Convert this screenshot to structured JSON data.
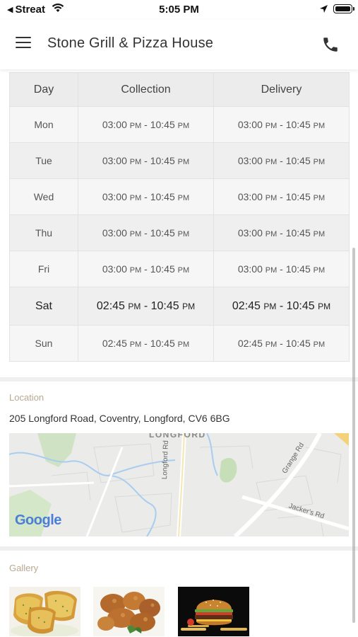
{
  "status_bar": {
    "back_app": "Streat",
    "time": "5:05 PM"
  },
  "header": {
    "title": "Stone Grill & Pizza House"
  },
  "hours_table": {
    "headers": [
      "Day",
      "Collection",
      "Delivery"
    ],
    "rows": [
      {
        "day": "Mon",
        "collection_start": "03:00",
        "collection_start_ampm": "PM",
        "collection_end": "10:45",
        "collection_end_ampm": "PM",
        "delivery_start": "03:00",
        "delivery_start_ampm": "PM",
        "delivery_end": "10:45",
        "delivery_end_ampm": "PM"
      },
      {
        "day": "Tue",
        "collection_start": "03:00",
        "collection_start_ampm": "PM",
        "collection_end": "10:45",
        "collection_end_ampm": "PM",
        "delivery_start": "03:00",
        "delivery_start_ampm": "PM",
        "delivery_end": "10:45",
        "delivery_end_ampm": "PM"
      },
      {
        "day": "Wed",
        "collection_start": "03:00",
        "collection_start_ampm": "PM",
        "collection_end": "10:45",
        "collection_end_ampm": "PM",
        "delivery_start": "03:00",
        "delivery_start_ampm": "PM",
        "delivery_end": "10:45",
        "delivery_end_ampm": "PM"
      },
      {
        "day": "Thu",
        "collection_start": "03:00",
        "collection_start_ampm": "PM",
        "collection_end": "10:45",
        "collection_end_ampm": "PM",
        "delivery_start": "03:00",
        "delivery_start_ampm": "PM",
        "delivery_end": "10:45",
        "delivery_end_ampm": "PM"
      },
      {
        "day": "Fri",
        "collection_start": "03:00",
        "collection_start_ampm": "PM",
        "collection_end": "10:45",
        "collection_end_ampm": "PM",
        "delivery_start": "03:00",
        "delivery_start_ampm": "PM",
        "delivery_end": "10:45",
        "delivery_end_ampm": "PM"
      },
      {
        "day": "Sat",
        "collection_start": "02:45",
        "collection_start_ampm": "PM",
        "collection_end": "10:45",
        "collection_end_ampm": "PM",
        "delivery_start": "02:45",
        "delivery_start_ampm": "PM",
        "delivery_end": "10:45",
        "delivery_end_ampm": "PM"
      },
      {
        "day": "Sun",
        "collection_start": "02:45",
        "collection_start_ampm": "PM",
        "collection_end": "10:45",
        "collection_end_ampm": "PM",
        "delivery_start": "02:45",
        "delivery_start_ampm": "PM",
        "delivery_end": "10:45",
        "delivery_end_ampm": "PM"
      }
    ],
    "highlighted_day": "Sat"
  },
  "location": {
    "label": "Location",
    "address": "205 Longford Road, Coventry, Longford, CV6 6BG",
    "map_labels": {
      "area": "LONGFORD",
      "road_1": "Longford Rd",
      "road_2": "Grange Rd",
      "road_3": "Jacker's Rd",
      "brand": "Google"
    }
  },
  "gallery": {
    "label": "Gallery",
    "images": [
      "garlic-bread-photo",
      "fried-chicken-photo",
      "burger-photo"
    ]
  },
  "colors": {
    "section_label": "#b8a990",
    "table_header_bg": "#ececec",
    "separator": "#efefef"
  }
}
